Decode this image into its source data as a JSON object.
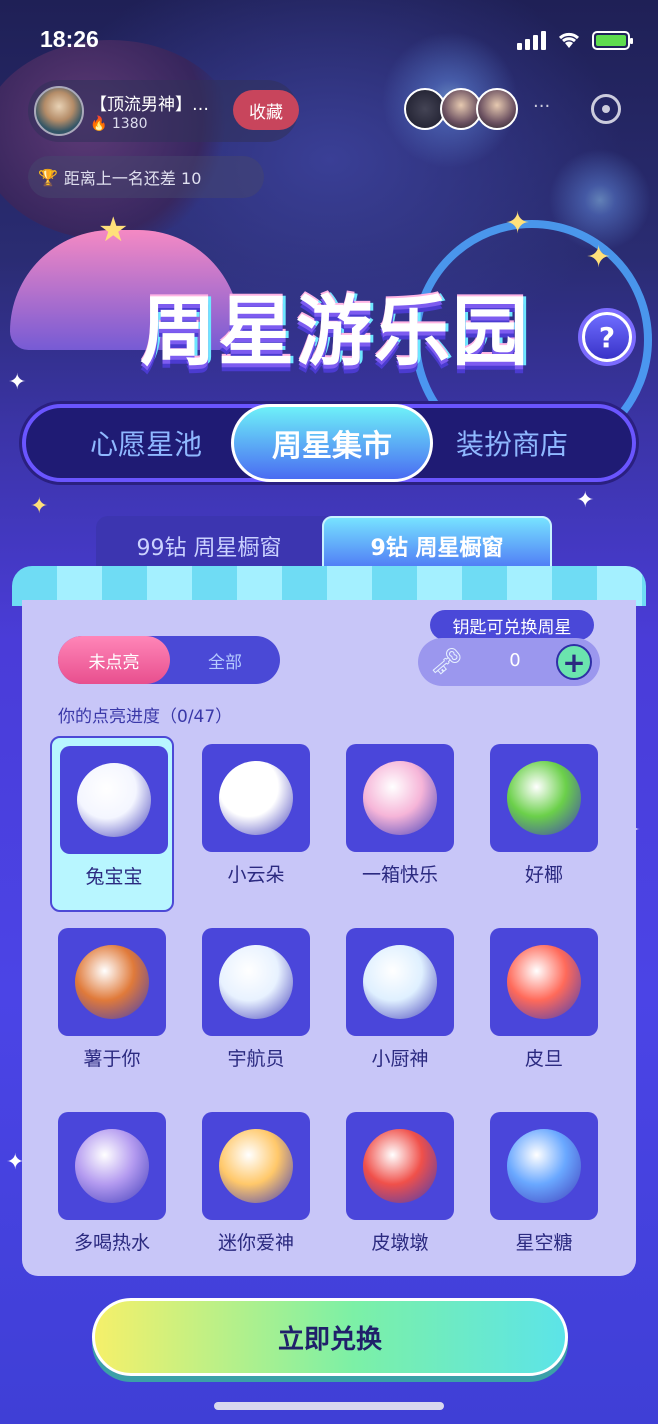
{
  "status": {
    "time": "18:26"
  },
  "host": {
    "name": "【顶流男神】…",
    "heat": "1380",
    "follow_label": "收藏"
  },
  "rank": {
    "text": "距离上一名还差 10"
  },
  "banner": {
    "title": "周星游乐园",
    "help": "?"
  },
  "tabs": [
    {
      "label": "心愿星池"
    },
    {
      "label": "周星集市",
      "active": true
    },
    {
      "label": "装扮商店"
    }
  ],
  "subtabs": [
    {
      "label": "99钻 周星橱窗"
    },
    {
      "label": "9钻 周星橱窗",
      "active": true
    }
  ],
  "filter": {
    "unlit": "未点亮",
    "all": "全部",
    "active": "未点亮"
  },
  "keys": {
    "tag": "钥匙可兑换周星",
    "count": "0",
    "add": "+"
  },
  "progress": {
    "text": "你的点亮进度（0/47）"
  },
  "items": [
    {
      "name": "兔宝宝",
      "selected": true,
      "color": "#f4f6ff"
    },
    {
      "name": "小云朵",
      "color": "#ffffff"
    },
    {
      "name": "一箱快乐",
      "color": "#f6b5d8"
    },
    {
      "name": "好椰",
      "color": "#6bd04a"
    },
    {
      "name": "薯于你",
      "color": "#e07a3a"
    },
    {
      "name": "宇航员",
      "color": "#e8f2ff"
    },
    {
      "name": "小厨神",
      "color": "#dff0ff"
    },
    {
      "name": "皮旦",
      "color": "#ff6a5a"
    },
    {
      "name": "多喝热水",
      "color": "#b49bf0"
    },
    {
      "name": "迷你爱神",
      "color": "#ffc86a"
    },
    {
      "name": "皮墩墩",
      "color": "#f0504a"
    },
    {
      "name": "星空糖",
      "color": "#6aa8ff"
    }
  ],
  "cta": {
    "label": "立即兑换"
  }
}
